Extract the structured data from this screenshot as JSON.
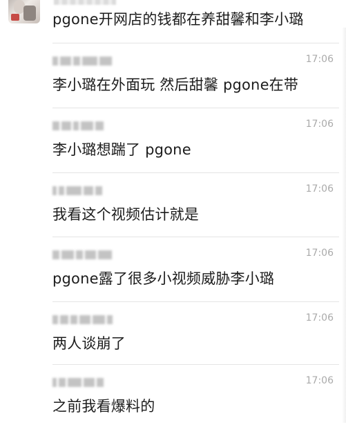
{
  "top_message": {
    "text": "pgone开网店的钱都在养甜馨和李小璐"
  },
  "messages": [
    {
      "time": "17:06",
      "text": "李小璐在外面玩 然后甜馨 pgone在带"
    },
    {
      "time": "17:06",
      "text": "李小璐想踹了 pgone"
    },
    {
      "time": "17:06",
      "text": "我看这个视频估计就是"
    },
    {
      "time": "17:06",
      "text": "pgone露了很多小视频威胁李小璐"
    },
    {
      "time": "17:06",
      "text": "两人谈崩了"
    },
    {
      "time": "17:06",
      "text": "之前我看爆料的"
    }
  ],
  "colors": {
    "text": "#1c1c1c",
    "time": "#aaaaaa",
    "divider": "#e4e4e4",
    "background": "#ffffff"
  }
}
